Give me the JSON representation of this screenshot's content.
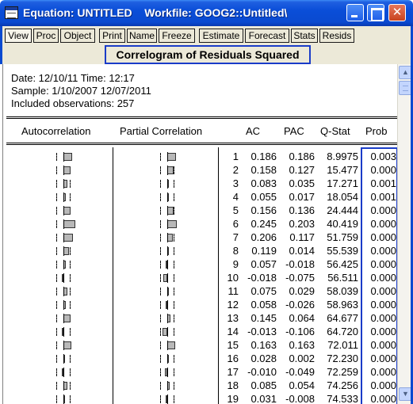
{
  "window": {
    "title": "Equation: UNTITLED    Workfile: GOOG2::Untitled\\",
    "controls": [
      "minimize",
      "maximize",
      "close"
    ]
  },
  "toolbar": [
    {
      "label": "View",
      "pressed": true
    },
    {
      "label": "Proc"
    },
    {
      "label": "Object"
    },
    {
      "label": "Print"
    },
    {
      "label": "Name"
    },
    {
      "label": "Freeze"
    },
    {
      "label": "Estimate"
    },
    {
      "label": "Forecast"
    },
    {
      "label": "Stats"
    },
    {
      "label": "Resids"
    }
  ],
  "view": {
    "header": "Correlogram of Residuals Squared",
    "info": {
      "date": "Date: 12/10/11   Time: 12:17",
      "sample": "Sample: 1/10/2007 12/07/2011",
      "observations": "Included observations: 257"
    },
    "columns": {
      "autocorrelation": "Autocorrelation",
      "partial": "Partial Correlation",
      "ac": "AC",
      "pac": "PAC",
      "qstat": "Q-Stat",
      "prob": "Prob"
    },
    "rows": [
      {
        "lag": "1",
        "ac": "0.186",
        "pac": "0.186",
        "q": "8.9975",
        "prob": "0.003"
      },
      {
        "lag": "2",
        "ac": "0.158",
        "pac": "0.127",
        "q": "15.477",
        "prob": "0.000"
      },
      {
        "lag": "3",
        "ac": "0.083",
        "pac": "0.035",
        "q": "17.271",
        "prob": "0.001"
      },
      {
        "lag": "4",
        "ac": "0.055",
        "pac": "0.017",
        "q": "18.054",
        "prob": "0.001"
      },
      {
        "lag": "5",
        "ac": "0.156",
        "pac": "0.136",
        "q": "24.444",
        "prob": "0.000"
      },
      {
        "lag": "6",
        "ac": "0.245",
        "pac": "0.203",
        "q": "40.419",
        "prob": "0.000"
      },
      {
        "lag": "7",
        "ac": "0.206",
        "pac": "0.117",
        "q": "51.759",
        "prob": "0.000"
      },
      {
        "lag": "8",
        "ac": "0.119",
        "pac": "0.014",
        "q": "55.539",
        "prob": "0.000"
      },
      {
        "lag": "9",
        "ac": "0.057",
        "pac": "-0.018",
        "q": "56.425",
        "prob": "0.000"
      },
      {
        "lag": "10",
        "ac": "-0.018",
        "pac": "-0.075",
        "q": "56.511",
        "prob": "0.000"
      },
      {
        "lag": "11",
        "ac": "0.075",
        "pac": "0.029",
        "q": "58.039",
        "prob": "0.000"
      },
      {
        "lag": "12",
        "ac": "0.058",
        "pac": "-0.026",
        "q": "58.963",
        "prob": "0.000"
      },
      {
        "lag": "13",
        "ac": "0.145",
        "pac": "0.064",
        "q": "64.677",
        "prob": "0.000"
      },
      {
        "lag": "14",
        "ac": "-0.013",
        "pac": "-0.106",
        "q": "64.720",
        "prob": "0.000"
      },
      {
        "lag": "15",
        "ac": "0.163",
        "pac": "0.163",
        "q": "72.011",
        "prob": "0.000"
      },
      {
        "lag": "16",
        "ac": "0.028",
        "pac": "0.002",
        "q": "72.230",
        "prob": "0.000"
      },
      {
        "lag": "17",
        "ac": "-0.010",
        "pac": "-0.049",
        "q": "72.259",
        "prob": "0.000"
      },
      {
        "lag": "18",
        "ac": "0.085",
        "pac": "0.054",
        "q": "74.256",
        "prob": "0.000"
      },
      {
        "lag": "19",
        "ac": "0.031",
        "pac": "-0.008",
        "q": "74.533",
        "prob": "0.000"
      }
    ]
  },
  "colors": {
    "title_bar": "#0a4ad0",
    "highlight_border": "#1a3cc8",
    "toolbar_bg": "#ece9d8",
    "bar_fill": "#b8b8b8"
  },
  "icons": {
    "app": "equation-window-icon",
    "scroll_up": "scroll-up-arrow-icon",
    "scroll_down": "scroll-down-arrow-icon"
  }
}
